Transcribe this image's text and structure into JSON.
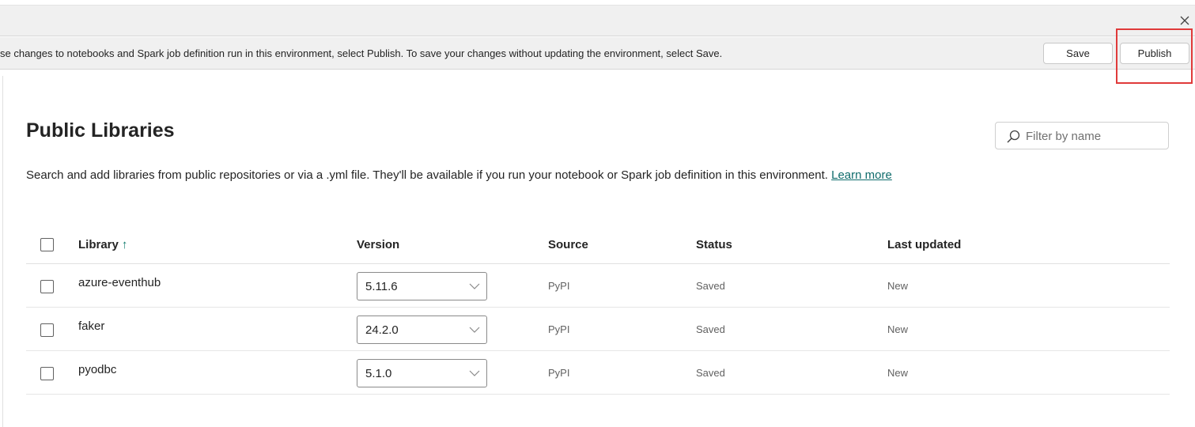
{
  "header": {
    "message": "se changes to notebooks and Spark job definition run in this environment, select Publish. To save your changes without updating the environment, select Save.",
    "save_label": "Save",
    "publish_label": "Publish"
  },
  "section": {
    "title": "Public Libraries",
    "description": "Search and add libraries from public repositories or via a .yml file. They'll be available if you run your notebook or Spark job definition in this environment.",
    "learn_more": "Learn more",
    "filter_placeholder": "Filter by name"
  },
  "table": {
    "columns": {
      "library": "Library",
      "version": "Version",
      "source": "Source",
      "status": "Status",
      "last_updated": "Last updated"
    },
    "sort_indicator": "↑",
    "rows": [
      {
        "library": "azure-eventhub",
        "version": "5.11.6",
        "source": "PyPI",
        "status": "Saved",
        "last_updated": "New"
      },
      {
        "library": "faker",
        "version": "24.2.0",
        "source": "PyPI",
        "status": "Saved",
        "last_updated": "New"
      },
      {
        "library": "pyodbc",
        "version": "5.1.0",
        "source": "PyPI",
        "status": "Saved",
        "last_updated": "New"
      }
    ]
  },
  "icons": {
    "close": "close-icon",
    "search": "search-icon",
    "dropdown": "chevron-down-icon"
  },
  "colors": {
    "accent_link": "#0f6c6c",
    "highlight_border": "#e03a3a",
    "bar_background": "#f0f0f0"
  }
}
